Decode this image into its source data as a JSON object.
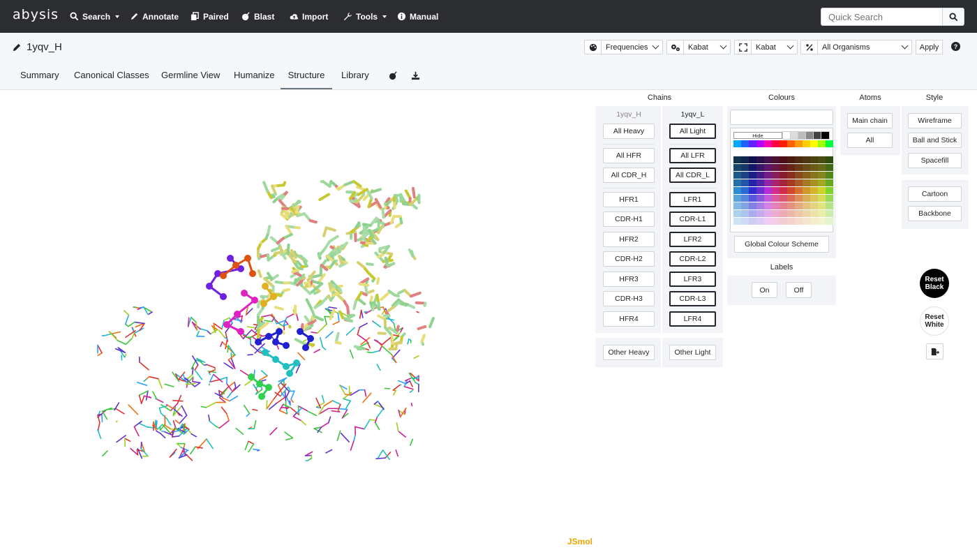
{
  "brand": "abysis",
  "nav": {
    "search": "Search",
    "annotate": "Annotate",
    "paired": "Paired",
    "blast": "Blast",
    "import": "Import",
    "tools": "Tools",
    "manual": "Manual"
  },
  "quick_search": {
    "placeholder": "Quick Search"
  },
  "page_title": "1yqv_H",
  "controls": {
    "frequencies": "Frequencies",
    "numbering": "Kabat",
    "cdr_def": "Kabat",
    "organisms": "All Organisms",
    "apply": "Apply"
  },
  "tabs": [
    "Summary",
    "Canonical Classes",
    "Germline View",
    "Humanize",
    "Structure",
    "Library"
  ],
  "active_tab": "Structure",
  "sections": {
    "chains": "Chains",
    "colours": "Colours",
    "atoms": "Atoms",
    "style": "Style",
    "labels": "Labels"
  },
  "heavy": {
    "name": "1yqv_H",
    "all": "All Heavy",
    "all_fr": "All HFR",
    "all_cdr": "All CDR_H",
    "regions": [
      "HFR1",
      "CDR-H1",
      "HFR2",
      "CDR-H2",
      "HFR3",
      "CDR-H3",
      "HFR4"
    ],
    "other": "Other Heavy"
  },
  "light": {
    "name": "1yqv_L",
    "all": "All Light",
    "all_fr": "All LFR",
    "all_cdr": "All CDR_L",
    "regions": [
      "LFR1",
      "CDR-L1",
      "LFR2",
      "CDR-L2",
      "LFR3",
      "CDR-L3",
      "LFR4"
    ],
    "other": "Other Light"
  },
  "palette": {
    "hide": "Hide",
    "global_scheme": "Global Colour Scheme"
  },
  "atoms": {
    "main_chain": "Main chain",
    "all": "All"
  },
  "style": {
    "wireframe": "Wireframe",
    "ball_stick": "Ball and Stick",
    "spacefill": "Spacefill",
    "cartoon": "Cartoon",
    "backbone": "Backbone"
  },
  "labels": {
    "on": "On",
    "off": "Off"
  },
  "reset": {
    "black": "Reset Black",
    "white": "Reset White"
  },
  "viewer": "JSmol",
  "colors": {
    "navbar": "#2b2d31",
    "viewer_brand": "#f0a500"
  }
}
